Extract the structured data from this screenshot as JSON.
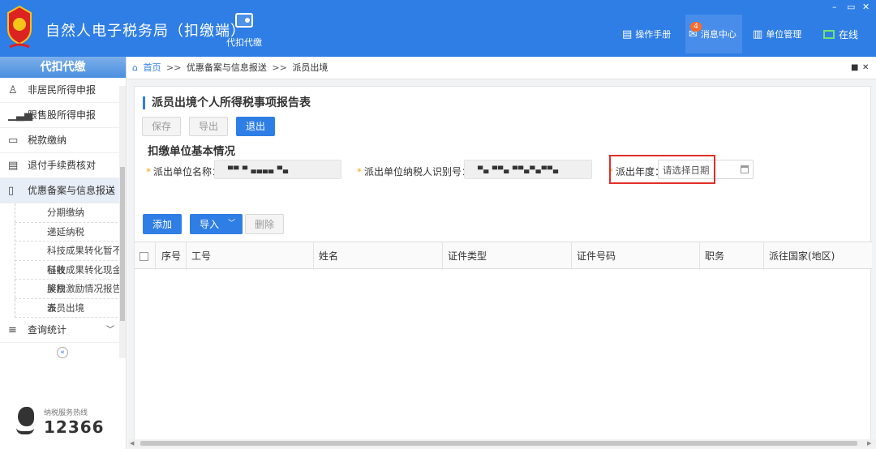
{
  "header": {
    "app_title": "自然人电子税务局（扣缴端）",
    "nav_main": "代扣代缴",
    "items": {
      "manual": "操作手册",
      "messages": "消息中心",
      "messages_badge": "4",
      "unit_mgmt": "单位管理",
      "online": "在线"
    },
    "window_controls": {
      "minimize": "–",
      "restore": "▭",
      "close": "✕"
    }
  },
  "sidebar": {
    "title": "代扣代缴",
    "items": [
      {
        "label": "非居民所得申报",
        "icon": "person-icon"
      },
      {
        "label": "限售股所得申报",
        "icon": "chart-icon"
      },
      {
        "label": "税款缴纳",
        "icon": "folder-icon"
      },
      {
        "label": "退付手续费核对",
        "icon": "list-icon"
      },
      {
        "label": "优惠备案与信息报送",
        "icon": "doc-icon",
        "expanded": true
      }
    ],
    "sub_items": [
      "分期缴纳",
      "递延纳税",
      "科技成果转化暂不征收",
      "科技成果转化现金奖励",
      "股权激励情况报告表",
      "派员出境"
    ],
    "last_item": {
      "label": "查询统计",
      "icon": "search-list-icon"
    },
    "hotline_label": "纳税服务热线",
    "hotline_number": "12366"
  },
  "breadcrumb": {
    "home": "首页",
    "sep": ">>",
    "level1": "优惠备案与信息报送",
    "level2": "派员出境"
  },
  "page": {
    "title": "派员出境个人所得税事项报告表",
    "buttons": {
      "save": "保存",
      "export": "导出",
      "exit": "退出"
    },
    "section_title": "扣缴单位基本情况",
    "fields": {
      "unit_name_label": "派出单位名称：",
      "unit_name_value": "▀▀ ▀ ▄▄▄▄ ▀▄",
      "taxpayer_id_label": "派出单位纳税人识别号：",
      "taxpayer_id_value": "▀▄ ▀▀▄ ▀▀▄▀▄▀▀▄",
      "year_label": "派出年度：",
      "year_placeholder": "请选择日期"
    },
    "table_buttons": {
      "add": "添加",
      "import": "导入",
      "delete": "删除"
    },
    "columns": [
      "序号",
      "工号",
      "姓名",
      "证件类型",
      "证件号码",
      "职务",
      "派往国家(地区)"
    ]
  }
}
